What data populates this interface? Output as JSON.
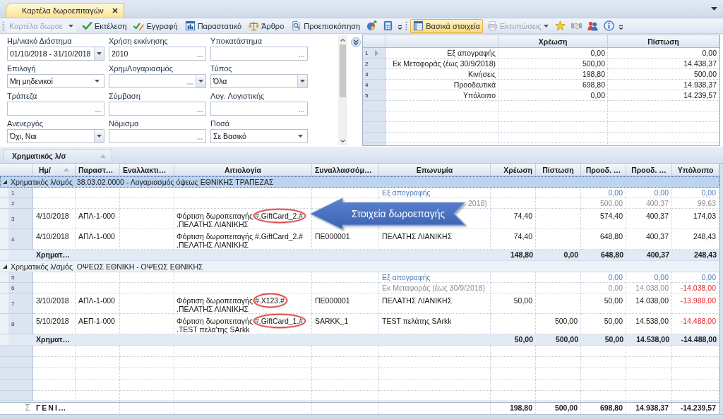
{
  "tabs": [
    {
      "label": "Καρτέλα δωροεπιταγών",
      "selected": true
    }
  ],
  "toolbar": {
    "groups": [
      {
        "items": [
          {
            "kind": "combo",
            "value": "Καρτέλα δωροε",
            "disabled": true
          },
          {
            "kind": "button",
            "label": "Εκτέλεση",
            "selected": false,
            "disabled": false
          },
          {
            "kind": "button",
            "label": "Εγγραφή",
            "selected": false,
            "disabled": false
          },
          {
            "kind": "button",
            "label": "Παραστατικό",
            "selected": false,
            "disabled": false
          },
          {
            "kind": "button",
            "label": "Άρθρο",
            "selected": false,
            "disabled": false
          },
          {
            "kind": "button",
            "label": "Προεπισκόπηση",
            "selected": false,
            "disabled": false
          },
          {
            "kind": "icon",
            "selected": false,
            "disabled": false
          },
          {
            "kind": "icon",
            "selected": false,
            "disabled": false
          }
        ]
      },
      {
        "items": [
          {
            "kind": "button",
            "label": "Βασικά στοιχεία",
            "selected": true,
            "disabled": false
          },
          {
            "kind": "button",
            "label": "Εκτυπώσεις",
            "selected": false,
            "disabled": true,
            "dropdown": true
          },
          {
            "kind": "icon",
            "selected": false,
            "disabled": false
          },
          {
            "kind": "icon",
            "selected": false,
            "disabled": false
          },
          {
            "kind": "icon",
            "selected": false,
            "disabled": false
          },
          {
            "kind": "icon",
            "selected": false,
            "disabled": false
          }
        ]
      }
    ]
  },
  "filters": [
    {
      "label": "Ημ/νιακό Διάστημα",
      "kind": "dropdown",
      "value": "01/10/2018 - 31/10/2018"
    },
    {
      "label": "Χρήση εκκίνησης",
      "kind": "lookup",
      "value": "2010"
    },
    {
      "label": "Υποκατάστημα",
      "kind": "lookup"
    },
    {
      "label": "Επιλογή",
      "kind": "combo",
      "value": "Μη μηδενικοί"
    },
    {
      "label": "ΧρημΛογαριασμός",
      "kind": "lookup_dropdown"
    },
    {
      "label": "Τύπος",
      "kind": "dropdown",
      "value": "Όλα"
    },
    {
      "label": "Τράπεζα",
      "kind": "lookup"
    },
    {
      "label": "Σύμβαση",
      "kind": "lookup"
    },
    {
      "label": "Λογ. Λογιστικής",
      "kind": "lookup"
    },
    {
      "label": "Ανενεργός",
      "kind": "dropdown",
      "value": "Όχι, Ναι"
    },
    {
      "label": "Νόμισμα",
      "kind": "lookup"
    },
    {
      "label": "Ποσά",
      "kind": "combo",
      "value": "Σε Βασικό"
    }
  ],
  "summary": {
    "columns": [
      {
        "label": "Χρέωση"
      },
      {
        "label": "Πίστωση"
      }
    ],
    "rows": [
      {
        "num": "1",
        "selected": true,
        "label": "Εξ απογραφής",
        "values": [
          "0,00",
          "0,00"
        ]
      },
      {
        "num": "2",
        "selected": false,
        "label": "Εκ Μεταφοράς (έως 30/9/2018)",
        "values": [
          "500,00",
          "14.438,37"
        ]
      },
      {
        "num": "3",
        "selected": false,
        "label": "Κινήσεις",
        "values": [
          "198,80",
          "500,00"
        ]
      },
      {
        "num": "4",
        "selected": false,
        "label": "Προοδευτικά",
        "values": [
          "698,80",
          "14.938,37"
        ]
      },
      {
        "num": "5",
        "selected": false,
        "label": "Υπόλοιπο",
        "values": [
          "0,00",
          "14.239,57"
        ]
      }
    ]
  },
  "grouping": {
    "columns": [
      {
        "label": "Χρηματικός λ/σ",
        "sorted": true
      }
    ]
  },
  "grid": {
    "columns": [
      {
        "label": "Ημ/",
        "sorted": true
      },
      {
        "label": "Παραστ…",
        "sorted": false
      },
      {
        "label": "Εναλλακτι…",
        "sorted": false
      },
      {
        "label": "Αιτιολογία",
        "sorted": false
      },
      {
        "label": "Συναλλασσόμ…",
        "sorted": false
      },
      {
        "label": "Επωνυμία",
        "sorted": false
      },
      {
        "label": "Χρέωση",
        "sorted": false
      },
      {
        "label": "Πίστωση",
        "sorted": false
      },
      {
        "label": "Προοδ. …",
        "sorted": false
      },
      {
        "label": "Προοδ. …",
        "sorted": false
      },
      {
        "label": "Υπόλοιπο",
        "sorted": false
      }
    ],
    "groups": [
      {
        "title": "Χρηματικός λ/σμός  38.03.02.0000 - Λογαριασμός όψεως ΕΘΝΙΚΗΣ ΤΡΑΠΕΖΑΣ",
        "expanded": true,
        "selected": true,
        "rows": [
          {
            "num": "1",
            "kind": "opening",
            "negative": false,
            "cells": [
              null,
              null,
              null,
              null,
              null,
              "Εξ απογραφής",
              null,
              null,
              "0,00",
              "0,00",
              "0,00"
            ]
          },
          {
            "num": "2",
            "kind": "carried",
            "negative": false,
            "covered": true,
            "cells": [
              null,
              null,
              null,
              null,
              null,
              "2018)",
              null,
              null,
              "500,00",
              "400,37",
              "99,63"
            ]
          },
          {
            "num": "3",
            "kind": "entry",
            "negative": false,
            "cells": [
              "4/10/2018",
              "ΑΠΛ-1-000",
              null,
              {
                "text": "Φόρτιση δωροπειταγής",
                "code": "#.GiftCard_2.#",
                "text_2": ".ΠΕΛΑΤΗΣ ΛΙΑΝΙΚΗΣ",
                "circled": true
              },
              null,
              null,
              "74,40",
              null,
              "574,40",
              "400,37",
              "174,03"
            ]
          },
          {
            "num": "4",
            "kind": "entry",
            "negative": false,
            "cells": [
              "4/10/2018",
              "ΑΠΛ-1-000",
              null,
              {
                "text": "Φόρτιση δωροπειταγής",
                "code": "#.GiftCard_2.#",
                "text_2": ".ΠΕΛΑΤΗΣ ΛΙΑΝΙΚΗΣ",
                "circled": false
              },
              "ΠΕ000001",
              "ΠΕΛΑΤΗΣ ΛΙΑΝΙΚΗΣ",
              "74,40",
              null,
              "648,80",
              "400,37",
              "248,43"
            ]
          }
        ],
        "footer": {
          "label": "Χρηματ…",
          "totals": [
            "148,80",
            "0,00",
            "648,80",
            "400,37",
            "248,43"
          ]
        }
      },
      {
        "title": "Χρηματικός λ/σμός  ΟΨΕΩΣ ΕΘΝΙΚΗ - ΟΨΕΩΣ ΕΘΝΙΚΗΣ",
        "expanded": true,
        "selected": false,
        "rows": [
          {
            "num": "5",
            "kind": "opening",
            "negative": false,
            "cells": [
              null,
              null,
              null,
              null,
              null,
              "Εξ απογραφής",
              null,
              null,
              "0,00",
              "0,00",
              "0,00"
            ]
          },
          {
            "num": "6",
            "kind": "carried",
            "negative": true,
            "cells": [
              null,
              null,
              null,
              null,
              null,
              "Εκ Μεταφοράς (έως 30/9/2018)",
              null,
              null,
              "0,00",
              "14.038,00",
              "-14.038,00"
            ]
          },
          {
            "num": "7",
            "kind": "entry",
            "negative": true,
            "cells": [
              "3/10/2018",
              "ΑΠΛ-1-000",
              null,
              {
                "text": "Φόρτιση δωροπειταγής",
                "code": "#.X123.#",
                "text_2": ".ΠΕΛΑΤΗΣ ΛΙΑΝΙΚΗΣ",
                "circled": true
              },
              "ΠΕ000001",
              "ΠΕΛΑΤΗΣ ΛΙΑΝΙΚΗΣ",
              "50,00",
              null,
              "50,00",
              "14.038,00",
              "-13.988,00"
            ]
          },
          {
            "num": "8",
            "kind": "entry",
            "negative": true,
            "cells": [
              "5/10/2018",
              "ΑΕΠ-1-000",
              null,
              {
                "text": "Φόρτιση δωροπειταγής",
                "code": "#.GiftCard_1.#",
                "text_2": ".TEST πελα'της SArkk",
                "circled": true
              },
              "SARKK_1",
              "TEST πελάτης SArkk",
              null,
              "500,00",
              "50,00",
              "14.538,00",
              "-14.488,00"
            ]
          }
        ],
        "footer": {
          "label": "Χρηματ…",
          "totals": [
            "50,00",
            "500,00",
            "50,00",
            "14.538,00",
            "-14.488,00"
          ]
        }
      }
    ],
    "total": {
      "symbol": "Σ",
      "label": "ΓΕΝΙ…",
      "totals": [
        "198,80",
        "500,00",
        "698,80",
        "14.938,37",
        "-14.239,57"
      ]
    }
  },
  "callout": {
    "text": "Στοιχεία δωροεπαγής"
  }
}
